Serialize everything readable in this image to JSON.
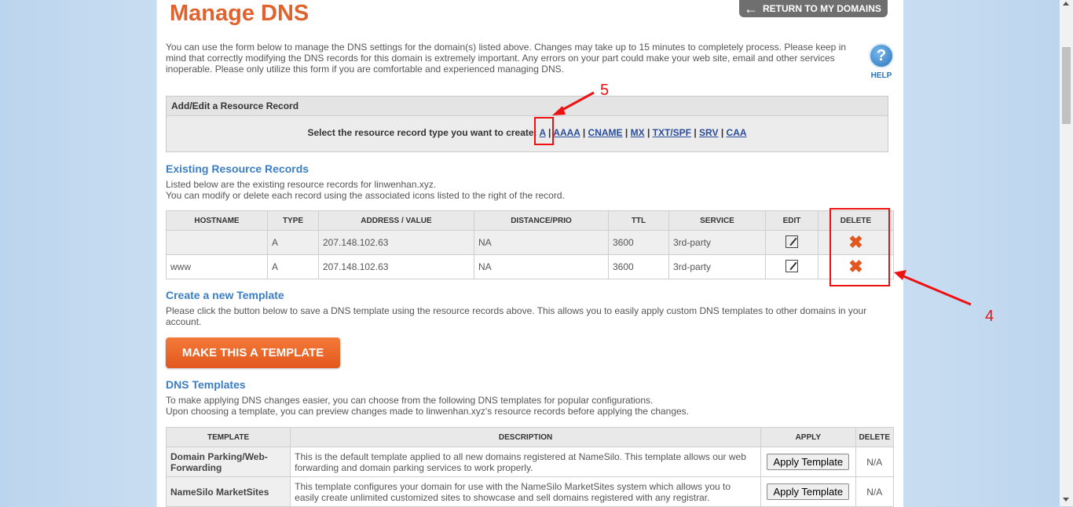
{
  "header": {
    "title": "Manage DNS",
    "return_label": "RETURN TO MY DOMAINS"
  },
  "intro": "You can use the form below to manage the DNS settings for the domain(s) listed above. Changes may take up to 15 minutes to completely process. Please keep in mind that correctly modifying the DNS records for this domain is extremely important. Any errors on your part could make your web site, email and other services inoperable. Please only utilize this form if you are comfortable and experienced managing DNS.",
  "help": {
    "icon": "?",
    "label": "HELP"
  },
  "add_edit": {
    "heading": "Add/Edit a Resource Record",
    "prompt": "Select the resource record type you want to create:",
    "types": [
      "A",
      "AAAA",
      "CNAME",
      "MX",
      "TXT/SPF",
      "SRV",
      "CAA"
    ],
    "separator": "|"
  },
  "existing": {
    "heading": "Existing Resource Records",
    "line1": "Listed below are the existing resource records for linwenhan.xyz.",
    "line2": "You can modify or delete each record using the associated icons listed to the right of the record.",
    "columns": [
      "HOSTNAME",
      "TYPE",
      "ADDRESS / VALUE",
      "DISTANCE/PRIO",
      "TTL",
      "SERVICE",
      "EDIT",
      "DELETE"
    ],
    "rows": [
      {
        "hostname": "",
        "type": "A",
        "address": "207.148.102.63",
        "distance": "NA",
        "ttl": "3600",
        "service": "3rd-party"
      },
      {
        "hostname": "www",
        "type": "A",
        "address": "207.148.102.63",
        "distance": "NA",
        "ttl": "3600",
        "service": "3rd-party"
      }
    ],
    "delete_glyph": "✖"
  },
  "create_template": {
    "heading": "Create a new Template",
    "text": "Please click the button below to save a DNS template using the resource records above. This allows you to easily apply custom DNS templates to other domains in your account.",
    "button_label": "MAKE THIS A TEMPLATE"
  },
  "dns_templates": {
    "heading": "DNS Templates",
    "line1": "To make applying DNS changes easier, you can choose from the following DNS templates for popular configurations.",
    "line2": "Upon choosing a template, you can preview changes made to linwenhan.xyz's resource records before applying the changes.",
    "columns": [
      "TEMPLATE",
      "DESCRIPTION",
      "APPLY",
      "DELETE"
    ],
    "rows": [
      {
        "name": "Domain Parking/Web-Forwarding",
        "description": "This is the default template applied to all new domains registered at NameSilo. This template allows our web forwarding and domain parking services to work properly.",
        "apply": "Apply Template",
        "delete": "N/A"
      },
      {
        "name": "NameSilo MarketSites",
        "description": "This template configures your domain for use with the NameSilo MarketSites system which allows you to easily create unlimited customized sites to showcase and sell domains registered with any registrar.",
        "apply": "Apply Template",
        "delete": "N/A"
      }
    ]
  },
  "annotations": {
    "a": "5",
    "b": "4"
  },
  "colors": {
    "title": "#e0622d",
    "link": "#2a4d9b",
    "section": "#3b7ec3",
    "annotation": "#ee1111",
    "delete": "#e2561f"
  }
}
